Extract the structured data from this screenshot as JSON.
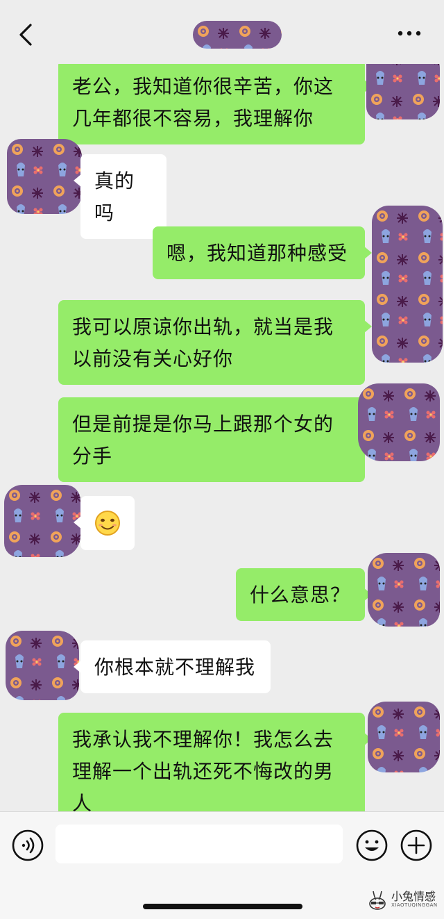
{
  "header": {
    "title": "",
    "back_icon": "chevron-left-icon",
    "more_icon": "more-dots-icon"
  },
  "messages": [
    {
      "from": "me",
      "text": "老公，我知道你很辛苦，你这几年都很不容易，我理解你"
    },
    {
      "from": "other",
      "text": "真的吗"
    },
    {
      "from": "me",
      "text": "嗯，我知道那种感受"
    },
    {
      "from": "me",
      "text": "我可以原谅你出轨，就当是我以前没有关心好你"
    },
    {
      "from": "me",
      "text": "但是前提是你马上跟那个女的分手"
    },
    {
      "from": "other",
      "text": "",
      "emoji": "smile-emoji"
    },
    {
      "from": "me",
      "text": "什么意思？"
    },
    {
      "from": "other",
      "text": "你根本就不理解我"
    },
    {
      "from": "me",
      "text": "我承认我不理解你！我怎么去理解一个出轨还死不悔改的男人"
    }
  ],
  "input_bar": {
    "voice_icon": "voice-icon",
    "input_value": "",
    "emoji_icon": "emoji-icon",
    "plus_icon": "plus-icon"
  },
  "watermark": {
    "name": "小兔情感",
    "url": "XIAOTUQINGGAN"
  },
  "colors": {
    "background": "#ededed",
    "my_bubble": "#95ec69",
    "other_bubble": "#ffffff",
    "mask_purple": "#7b5a8f"
  }
}
